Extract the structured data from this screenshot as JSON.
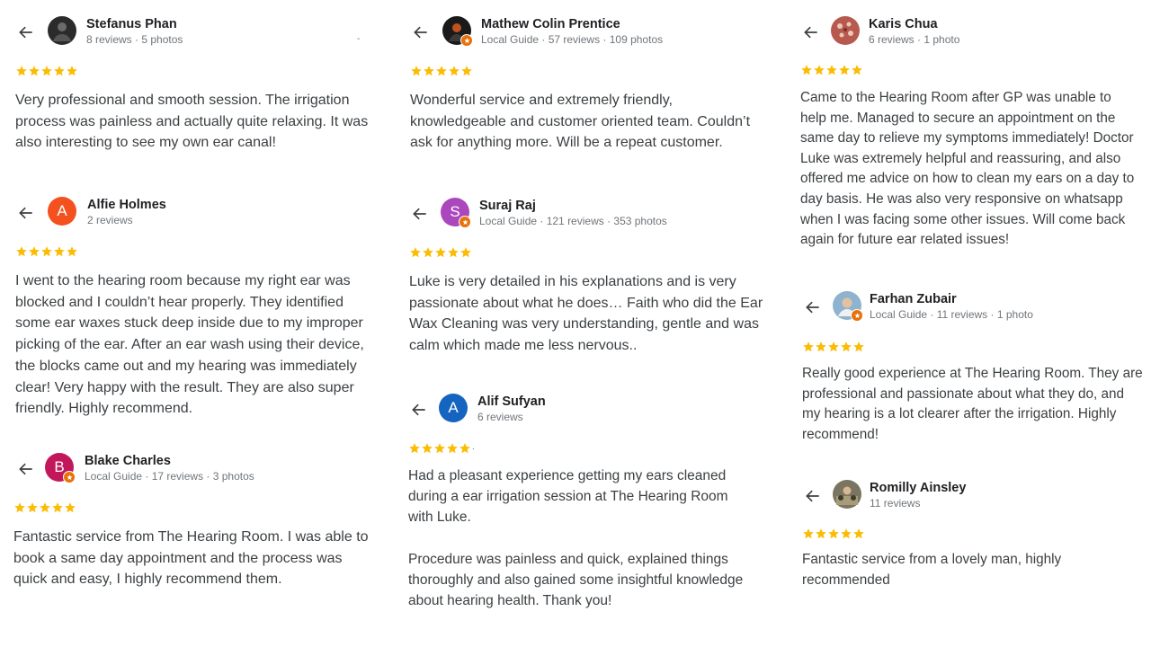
{
  "colors": {
    "star": "#fbbc04",
    "text": "#3c4043",
    "meta": "#70757a",
    "local_guide_badge": "#e8710a"
  },
  "reviews": [
    {
      "name": "Stefanus Phan",
      "meta": "8 reviews · 5 photos",
      "avatar_type": "photo",
      "avatar_color": "#2b2b2b",
      "avatar_letter": "",
      "local_guide": false,
      "rating": 5,
      "text": "Very professional and smooth session. The irrigation\nprocess was painless and actually quite relaxing. It was\nalso interesting to see my own ear canal!"
    },
    {
      "name": "Alfie Holmes",
      "meta": "2 reviews",
      "avatar_type": "letter",
      "avatar_color": "#f4511e",
      "avatar_letter": "A",
      "local_guide": false,
      "rating": 5,
      "text": "I went to the hearing room because my right ear was\nblocked and I couldn’t hear properly. They identified\nsome ear waxes stuck deep inside due to my improper\npicking of the ear. After an ear wash using their device,\nthe blocks came out and my hearing was immediately\nclear! Very happy with the result. They are also super\nfriendly. Highly recommend."
    },
    {
      "name": "Blake Charles",
      "meta": "Local Guide · 17 reviews · 3 photos",
      "avatar_type": "letter",
      "avatar_color": "#c2185b",
      "avatar_letter": "B",
      "local_guide": true,
      "rating": 5,
      "text": "Fantastic service from The Hearing Room. I was able to\nbook a same day appointment and the process was\nquick and easy, I highly recommend them."
    },
    {
      "name": "Mathew Colin Prentice",
      "meta": "Local Guide · 57 reviews · 109 photos",
      "avatar_type": "photo",
      "avatar_color": "#1a1a1a",
      "avatar_letter": "",
      "local_guide": true,
      "rating": 5,
      "text": "Wonderful service and extremely friendly,\nknowledgeable and customer oriented team. Couldn’t\nask for anything more. Will be a repeat customer."
    },
    {
      "name": "Suraj Raj",
      "meta": "Local Guide · 121 reviews · 353 photos",
      "avatar_type": "letter",
      "avatar_color": "#ab47bc",
      "avatar_letter": "S",
      "local_guide": true,
      "rating": 5,
      "text": "Luke is very detailed in his explanations and is very\npassionate about what he does… Faith who did the Ear\nWax Cleaning was very understanding, gentle and was\ncalm which made me less nervous.."
    },
    {
      "name": "Alif Sufyan",
      "meta": "6 reviews",
      "avatar_type": "letter",
      "avatar_color": "#1565c0",
      "avatar_letter": "A",
      "local_guide": false,
      "rating": 5,
      "text": "Had a pleasant experience getting my ears cleaned\nduring a ear irrigation session at The Hearing Room\nwith Luke.\n\nProcedure was painless and quick, explained things\nthoroughly and also gained some insightful knowledge\nabout hearing health. Thank you!"
    },
    {
      "name": "Karis Chua",
      "meta": "6 reviews · 1 photo",
      "avatar_type": "photo",
      "avatar_color": "#b8594f",
      "avatar_letter": "",
      "local_guide": false,
      "rating": 5,
      "text": "Came to the Hearing Room after GP was unable to\nhelp me. Managed to secure an appointment on the\nsame day to relieve my symptoms immediately! Doctor\nLuke was extremely helpful and reassuring, and also\noffered me advice on how to clean my ears on a day to\nday basis. He was also very responsive on whatsapp\nwhen I was facing some other issues. Will come back\nagain for future ear related issues!"
    },
    {
      "name": "Farhan Zubair",
      "meta": "Local Guide · 11 reviews · 1 photo",
      "avatar_type": "photo",
      "avatar_color": "#8fb3cf",
      "avatar_letter": "",
      "local_guide": true,
      "rating": 5,
      "text": "Really good experience at The Hearing Room. They are\nprofessional and passionate about what they do, and\nmy hearing is a lot clearer after the irrigation. Highly\nrecommend!"
    },
    {
      "name": "Romilly Ainsley",
      "meta": "11 reviews",
      "avatar_type": "photo",
      "avatar_color": "#7a7560",
      "avatar_letter": "",
      "local_guide": false,
      "rating": 5,
      "text": "Fantastic service from a lovely man, highly\nrecommended"
    }
  ]
}
